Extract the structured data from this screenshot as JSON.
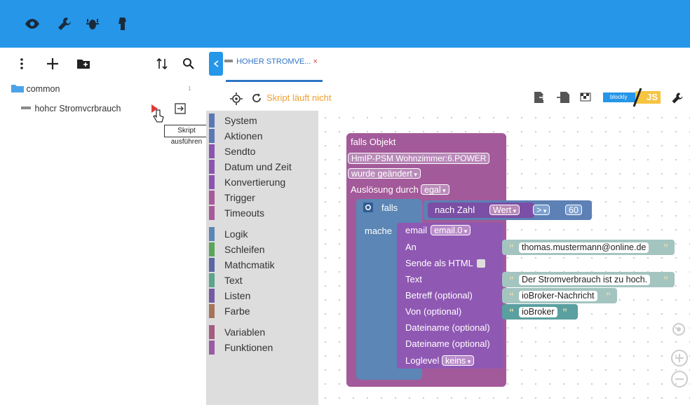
{
  "tab": {
    "title": "HOHER STROMVE...",
    "close": "×"
  },
  "tree": {
    "folder": "common",
    "folder_count": "1",
    "script": "hohcr Stromvcrbrauch"
  },
  "tooltip": "Skript ausführen",
  "status": "Skript läuft nicht",
  "blockly_label": "blockly",
  "js_label": "JS",
  "categories": [
    "System",
    "Aktionen",
    "Sendto",
    "Datum und Zeit",
    "Konvertierung",
    "Trigger",
    "Timeouts",
    "Logik",
    "Schleifen",
    "Mathcmatik",
    "Text",
    "Listen",
    "Farbe",
    "Variablen",
    "Funktionen"
  ],
  "colors": {
    "topbar": "#2596e8",
    "event_block": "#a35a9a",
    "email_block": "#8f58b3",
    "logic_block": "#5b86b5",
    "math_block": "#5d80b5",
    "text_block": "#5aa0a0"
  },
  "blocks": {
    "trigger": {
      "title": "falls Objekt",
      "object": "HmIP-PSM Wohnzimmer:6.POWER",
      "changed": "wurde geändert",
      "trigger_label": "Auslösung durch",
      "trigger_value": "egal"
    },
    "if": {
      "label": "falls",
      "do_label": "mache"
    },
    "condition": {
      "fn": "nach Zahl",
      "field": "Wert",
      "op": ">",
      "value": "60"
    },
    "email": {
      "label": "email",
      "instance": "email.0",
      "to_label": "An",
      "to_value": "thomas.mustermann@online.de",
      "html_label": "Sende als HTML",
      "text_label": "Text",
      "text_value": "Der Stromverbrauch ist zu hoch.",
      "subject_label": "Betreff (optional)",
      "subject_value": "ioBroker-Nachricht",
      "from_label": "Von (optional)",
      "from_value": "ioBroker",
      "file1_label": "Dateiname (optional)",
      "file2_label": "Dateiname (optional)",
      "loglevel_label": "Loglevel",
      "loglevel_value": "keins"
    }
  }
}
